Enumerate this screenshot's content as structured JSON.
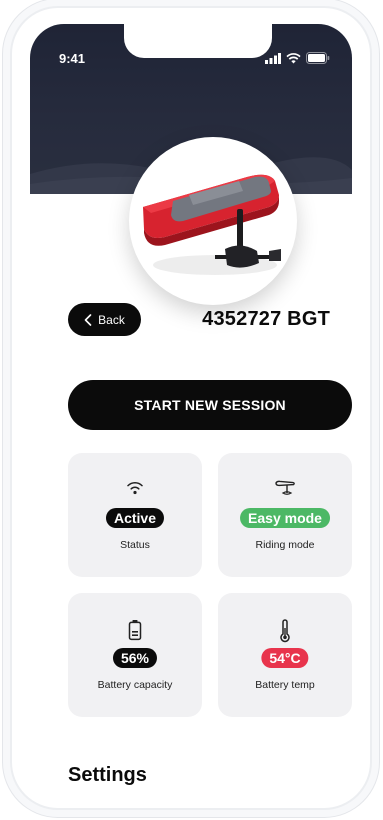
{
  "status_bar": {
    "time": "9:41"
  },
  "device": {
    "id": "4352727 BGT"
  },
  "nav": {
    "back_label": "Back"
  },
  "actions": {
    "start_session_label": "START NEW SESSION"
  },
  "stats": [
    {
      "value": "Active",
      "label": "Status",
      "icon": "wifi-icon",
      "color": "#0b0b0b"
    },
    {
      "value": "Easy mode",
      "label": "Riding mode",
      "icon": "hydrofoil-icon",
      "color": "#4cb865"
    },
    {
      "value": "56%",
      "label": "Battery capacity",
      "icon": "battery-icon",
      "color": "#0b0b0b"
    },
    {
      "value": "54°C",
      "label": "Battery temp",
      "icon": "thermometer-icon",
      "color": "#e8344c"
    }
  ],
  "sections": {
    "settings_title": "Settings"
  }
}
